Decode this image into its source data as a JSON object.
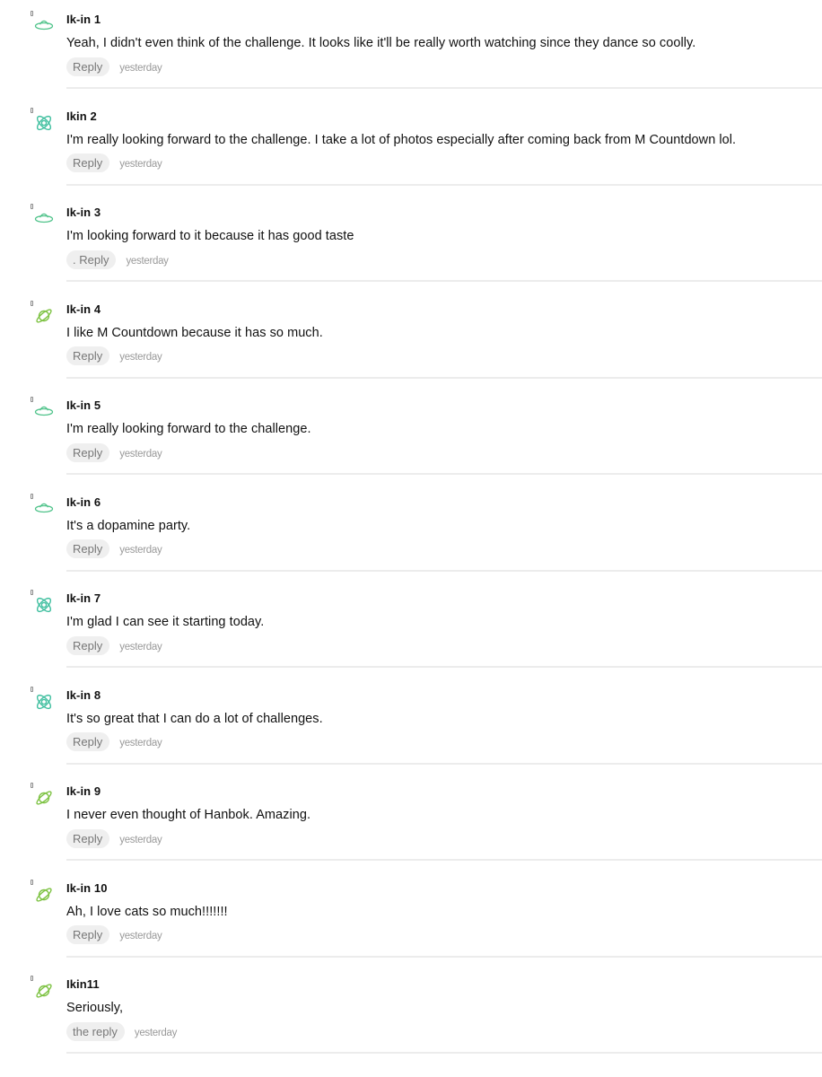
{
  "icons": {
    "saucer": "ufo-icon",
    "atom": "atom-icon",
    "planet": "planet-icon"
  },
  "colors": {
    "saucer": "#4fc38a",
    "atom": "#3fbf9f",
    "planet": "#7dc242"
  },
  "comments": [
    {
      "icon": "saucer",
      "author": "Ik-in 1",
      "text": "Yeah, I didn't even think of the challenge. It looks like it'll be really worth watching since they dance so coolly.",
      "reply": "Reply",
      "time": "yesterday"
    },
    {
      "icon": "atom",
      "author": "Ikin 2",
      "text": "I'm really looking forward to the challenge. I take a lot of photos especially after coming back from M Countdown lol.",
      "reply": "Reply",
      "time": "yesterday"
    },
    {
      "icon": "saucer",
      "author": "Ik-in 3",
      "text": "I'm looking forward to it because it has good taste",
      "reply": ". Reply",
      "time": "yesterday"
    },
    {
      "icon": "planet",
      "author": "Ik-in 4",
      "text": "I like M Countdown because it has so much.",
      "reply": "Reply",
      "time": "yesterday"
    },
    {
      "icon": "saucer",
      "author": "Ik-in 5",
      "text": "I'm really looking forward to the challenge.",
      "reply": "Reply",
      "time": "yesterday"
    },
    {
      "icon": "saucer",
      "author": "Ik-in 6",
      "text": "It's a dopamine party.",
      "reply": "Reply",
      "time": "yesterday"
    },
    {
      "icon": "atom",
      "author": "Ik-in 7",
      "text": "I'm glad I can see it starting today.",
      "reply": "Reply",
      "time": "yesterday"
    },
    {
      "icon": "atom",
      "author": "Ik-in 8",
      "text": "It's so great that I can do a lot of challenges.",
      "reply": "Reply",
      "time": "yesterday"
    },
    {
      "icon": "planet",
      "author": "Ik-in 9",
      "text": "I never even thought of Hanbok. Amazing.",
      "reply": "Reply",
      "time": "yesterday"
    },
    {
      "icon": "planet",
      "author": "Ik-in 10",
      "text": "Ah, I love cats so much!!!!!!!",
      "reply": "Reply",
      "time": "yesterday"
    },
    {
      "icon": "planet",
      "author": "Ikin11",
      "text": "Seriously,",
      "reply": "the reply",
      "time": "yesterday"
    }
  ]
}
